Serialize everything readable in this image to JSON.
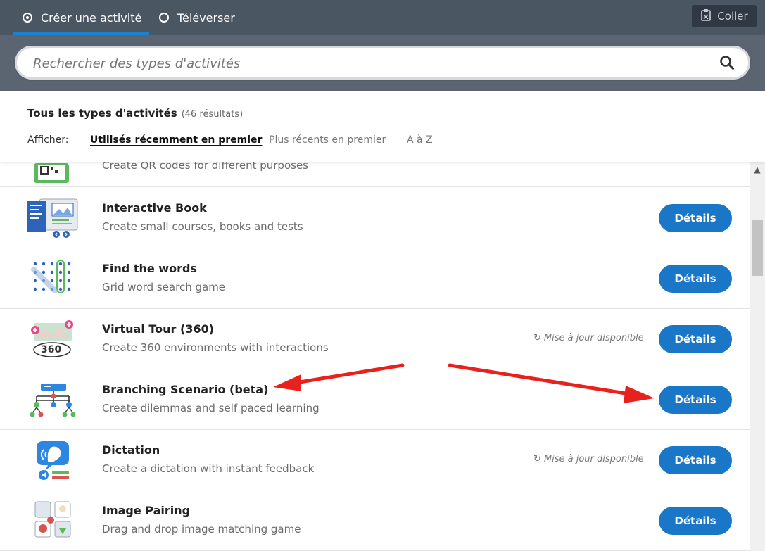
{
  "tabs": [
    {
      "label": "Créer une activité",
      "selected": true
    },
    {
      "label": "Téléverser",
      "selected": false
    }
  ],
  "paste_button": "Coller",
  "search": {
    "placeholder": "Rechercher des types d'activités"
  },
  "header": {
    "title": "Tous les types d'activités",
    "count": "(46 résultats)",
    "sort_label": "Afficher:",
    "sort_options": [
      "Utilisés récemment en premier",
      "Plus récents en premier",
      "A à Z"
    ],
    "sort_active": "Utilisés récemment en premier"
  },
  "rows": [
    {
      "title": "",
      "desc": "Create QR codes for different purposes",
      "icon": "qr-code-icon",
      "update": ""
    },
    {
      "title": "Interactive Book",
      "desc": "Create small courses, books and tests",
      "icon": "interactive-book-icon",
      "update": "",
      "button": "Détails"
    },
    {
      "title": "Find the words",
      "desc": "Grid word search game",
      "icon": "word-grid-icon",
      "update": "",
      "button": "Détails"
    },
    {
      "title": "Virtual Tour (360)",
      "desc": "Create 360 environments with interactions",
      "icon": "virtual-tour-icon",
      "update": "Mise à jour disponible",
      "button": "Détails"
    },
    {
      "title": "Branching Scenario (beta)",
      "desc": "Create dilemmas and self paced learning",
      "icon": "branching-tree-icon",
      "update": "",
      "button": "Détails"
    },
    {
      "title": "Dictation",
      "desc": "Create a dictation with instant feedback",
      "icon": "dictation-icon",
      "update": "Mise à jour disponible",
      "button": "Détails"
    },
    {
      "title": "Image Pairing",
      "desc": "Drag and drop image matching game",
      "icon": "image-pairing-icon",
      "update": "",
      "button": "Détails"
    }
  ],
  "colors": {
    "accent": "#1a76c7",
    "annotation_arrow": "#e8211d",
    "topbar": "#4b5663"
  }
}
